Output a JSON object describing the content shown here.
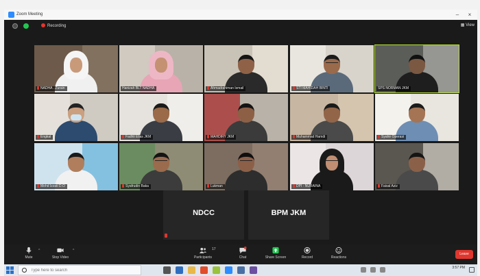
{
  "window": {
    "title": "Zoom Meeting",
    "minimize_icon": "minimize-icon",
    "close_icon": "close-icon"
  },
  "status_bar": {
    "recording_label": "Recording",
    "view_label": "View"
  },
  "participants": [
    {
      "name": "NADHA . Zurain",
      "muted": true,
      "theme": "woman-white-hijab"
    },
    {
      "name": "Hanizah BLT NADHA",
      "muted": false,
      "theme": "woman-pink-hijab"
    },
    {
      "name": "Ahmadrahiman Ismail",
      "muted": true,
      "theme": "man-office"
    },
    {
      "name": "STI MAHIDAH BINTI",
      "muted": true,
      "theme": "man-glasses"
    },
    {
      "name": "SPS NORMAN JKM",
      "muted": false,
      "theme": "man-window",
      "active": true
    },
    {
      "name": "Engkal",
      "muted": true,
      "theme": "man-mask"
    },
    {
      "name": "Fadhli Elias JKM",
      "muted": true,
      "theme": "man-white-wall"
    },
    {
      "name": "MAHDIRY JKM",
      "muted": true,
      "theme": "man-red-flag"
    },
    {
      "name": "Muhammad Hamdi",
      "muted": true,
      "theme": "man-curtain"
    },
    {
      "name": "Syahir Operasi",
      "muted": true,
      "theme": "man-bright"
    },
    {
      "name": "Mohd Izzati D.O",
      "muted": true,
      "theme": "man-blue-panel"
    },
    {
      "name": "Syafrudin Baka",
      "muted": true,
      "theme": "man-green-pattern"
    },
    {
      "name": "Lukman",
      "muted": true,
      "theme": "man-closeup"
    },
    {
      "name": "DPI - NURAINA",
      "muted": true,
      "theme": "woman-black-hijab"
    },
    {
      "name": "Faisal Aziz",
      "muted": true,
      "theme": "man-car"
    }
  ],
  "text_tiles": [
    {
      "label": "NDCC"
    },
    {
      "label": "BPM JKM"
    }
  ],
  "toolbar": {
    "mute": "Mute",
    "stop_video": "Stop Video",
    "participants": "Participants",
    "participants_count": "17",
    "chat": "Chat",
    "share_screen": "Share Screen",
    "record": "Record",
    "reactions": "Reactions",
    "end": "Leave"
  },
  "taskbar": {
    "search_placeholder": "Type here to search",
    "time": "3:57 PM"
  },
  "colors": {
    "recording_red": "#e0362e",
    "active_speaker": "#b9e33a",
    "share_green": "#23c552",
    "zoom_blue": "#2d8cff"
  }
}
